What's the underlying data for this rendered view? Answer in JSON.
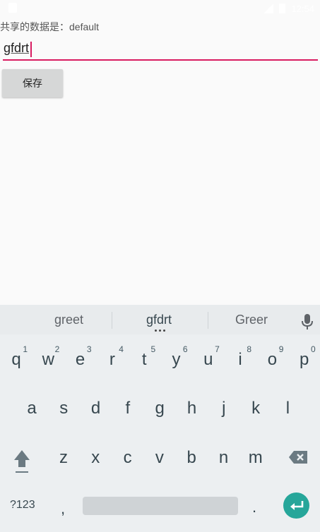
{
  "status_bar": {
    "time": "12:54"
  },
  "main": {
    "shared_label": "共享的数据是：default",
    "input_value": "gfdrt",
    "save_label": "保存"
  },
  "keyboard": {
    "suggestions": [
      "greet",
      "gfdrt",
      "Greer"
    ],
    "row1": [
      {
        "char": "q",
        "hint": "1"
      },
      {
        "char": "w",
        "hint": "2"
      },
      {
        "char": "e",
        "hint": "3"
      },
      {
        "char": "r",
        "hint": "4"
      },
      {
        "char": "t",
        "hint": "5"
      },
      {
        "char": "y",
        "hint": "6"
      },
      {
        "char": "u",
        "hint": "7"
      },
      {
        "char": "i",
        "hint": "8"
      },
      {
        "char": "o",
        "hint": "9"
      },
      {
        "char": "p",
        "hint": "0"
      }
    ],
    "row2": [
      "a",
      "s",
      "d",
      "f",
      "g",
      "h",
      "j",
      "k",
      "l"
    ],
    "row3": [
      "z",
      "x",
      "c",
      "v",
      "b",
      "n",
      "m"
    ],
    "sym_label": "?123",
    "comma": ",",
    "period": ".",
    "accent_color": "#26a69a"
  },
  "colors": {
    "input_underline": "#d81b60",
    "button_bg": "#d6d7d7",
    "keyboard_bg": "#eceff1"
  }
}
